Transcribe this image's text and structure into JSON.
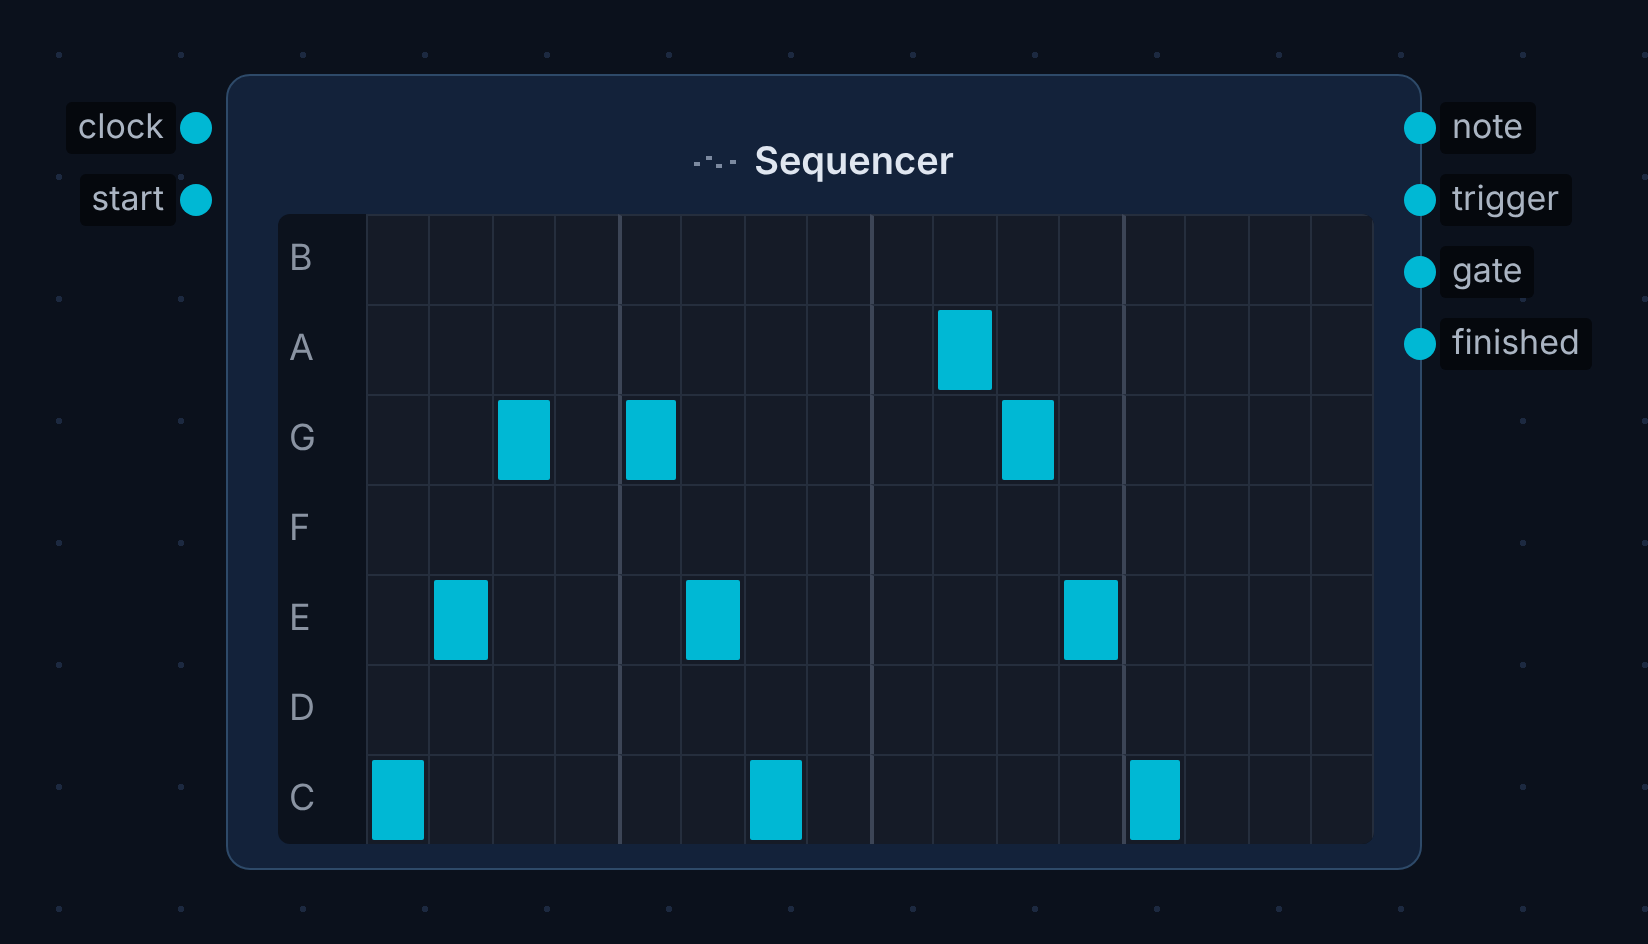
{
  "node": {
    "title": "Sequencer"
  },
  "inputs": [
    {
      "label": "clock"
    },
    {
      "label": "start"
    }
  ],
  "outputs": [
    {
      "label": "note"
    },
    {
      "label": "trigger"
    },
    {
      "label": "gate"
    },
    {
      "label": "finished"
    }
  ],
  "grid": {
    "rows": [
      {
        "note": "B",
        "steps": [
          false,
          false,
          false,
          false,
          false,
          false,
          false,
          false,
          false,
          false,
          false,
          false,
          false,
          false,
          false,
          false
        ]
      },
      {
        "note": "A",
        "steps": [
          false,
          false,
          false,
          false,
          false,
          false,
          false,
          false,
          false,
          true,
          false,
          false,
          false,
          false,
          false,
          false
        ]
      },
      {
        "note": "G",
        "steps": [
          false,
          false,
          true,
          false,
          true,
          false,
          false,
          false,
          false,
          false,
          true,
          false,
          false,
          false,
          false,
          false
        ]
      },
      {
        "note": "F",
        "steps": [
          false,
          false,
          false,
          false,
          false,
          false,
          false,
          false,
          false,
          false,
          false,
          false,
          false,
          false,
          false,
          false
        ]
      },
      {
        "note": "E",
        "steps": [
          false,
          true,
          false,
          false,
          false,
          true,
          false,
          false,
          false,
          false,
          false,
          true,
          false,
          false,
          false,
          false
        ]
      },
      {
        "note": "D",
        "steps": [
          false,
          false,
          false,
          false,
          false,
          false,
          false,
          false,
          false,
          false,
          false,
          false,
          false,
          false,
          false,
          false
        ]
      },
      {
        "note": "C",
        "steps": [
          true,
          false,
          false,
          false,
          false,
          false,
          true,
          false,
          false,
          false,
          false,
          false,
          true,
          false,
          false,
          false
        ]
      }
    ]
  }
}
